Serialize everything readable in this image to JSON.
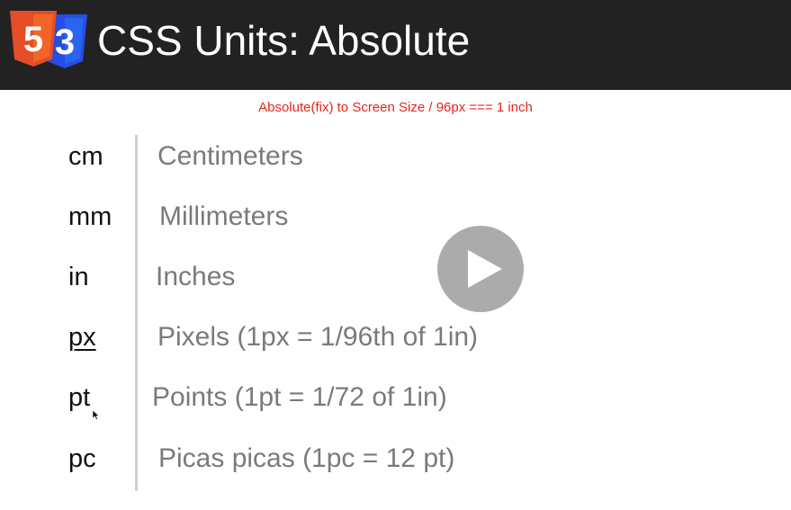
{
  "header": {
    "logo_html5_label": "5",
    "logo_css3_label": "3",
    "title": "CSS Units: Absolute"
  },
  "subtitle": "Absolute(fix) to Screen Size / 96px === 1 inch",
  "units": [
    {
      "unit": "cm",
      "description": "Centimeters"
    },
    {
      "unit": "mm",
      "description": "Millimeters"
    },
    {
      "unit": "in",
      "description": "Inches"
    },
    {
      "unit": "px",
      "description": "Pixels (1px = 1/96th of 1in)"
    },
    {
      "unit": "pt",
      "description": "Points (1pt = 1/72 of 1in)"
    },
    {
      "unit": "pc",
      "description": "Picas picas (1pc = 12 pt)"
    }
  ],
  "video": {
    "play_icon": "play-icon"
  },
  "colors": {
    "header_bg": "#222222",
    "subtitle": "#e8251a",
    "html5_orange": "#e44d26",
    "css3_blue": "#264de4",
    "play_button": "#ababab"
  }
}
